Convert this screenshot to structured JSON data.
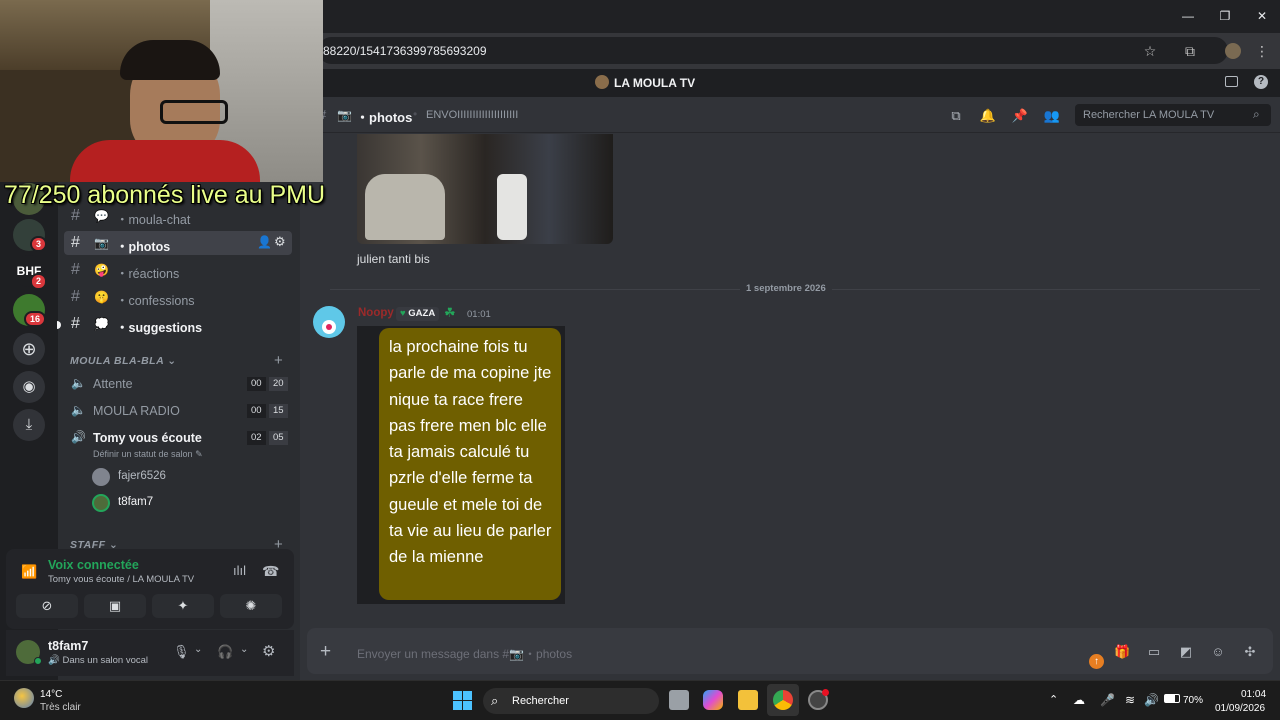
{
  "browser": {
    "url": "88220/1541736399785693209"
  },
  "app": {
    "server_name": "LA MOULA TV"
  },
  "overlay": {
    "stream_text": "77/250 abonnés live au PMU"
  },
  "rail": {
    "badges": [
      "3",
      "2",
      "16"
    ],
    "bhf_label": "BHF"
  },
  "sidebar": {
    "channels": [
      {
        "emoji": "💬",
        "name": "moula-chat"
      },
      {
        "emoji": "📷",
        "name": "photos"
      },
      {
        "emoji": "🤪",
        "name": "réactions"
      },
      {
        "emoji": "🤫",
        "name": "confessions"
      },
      {
        "emoji": "💭",
        "name": "suggestions"
      }
    ],
    "category_1": "MOULA BLA-BLA",
    "category_2": "STAFF",
    "voice_channels": [
      {
        "name": "Attente",
        "count_a": "00",
        "count_b": "20"
      },
      {
        "name": "MOULA RADIO",
        "count_a": "00",
        "count_b": "15"
      },
      {
        "name": "Tomy vous écoute",
        "count_a": "02",
        "count_b": "05"
      }
    ],
    "voice_status_hint": "Définir un statut de salon",
    "voice_users": [
      "fajer6526",
      "t8fam7"
    ]
  },
  "voice_panel": {
    "status": "Voix connectée",
    "location": "Tomy vous écoute / LA MOULA TV"
  },
  "user": {
    "name": "t8fam7",
    "status": "Dans un salon vocal"
  },
  "header": {
    "channel_emoji": "📷",
    "channel_name": "photos",
    "topic": "ENVOIIIIIIIIIIIIIIIIIIII",
    "search_placeholder": "Rechercher LA MOULA TV"
  },
  "messages": {
    "caption": "julien tanti bis",
    "date_divider": "1 septembre 2026",
    "author": "Noopy",
    "tag": "GAZA",
    "time": "01:01",
    "image_text": "la prochaine fois tu parle de ma copine jte nique ta race frere pas frere men blc elle ta jamais calculé tu pzrle d'elle ferme ta gueule et mele toi de ta vie au lieu de parler de la mienne"
  },
  "composer": {
    "placeholder": "Envoyer un message dans #📷・photos"
  },
  "taskbar": {
    "weather_temp": "14°C",
    "weather_desc": "Très clair",
    "search_label": "Rechercher",
    "battery": "70%",
    "time": "01:04",
    "date": "01/09/2026"
  },
  "colors": {
    "voice_green": "#23a55a",
    "badge_red": "#da373c",
    "bubble_olive": "#6f5f00",
    "author_red": "#9c2a2a"
  }
}
